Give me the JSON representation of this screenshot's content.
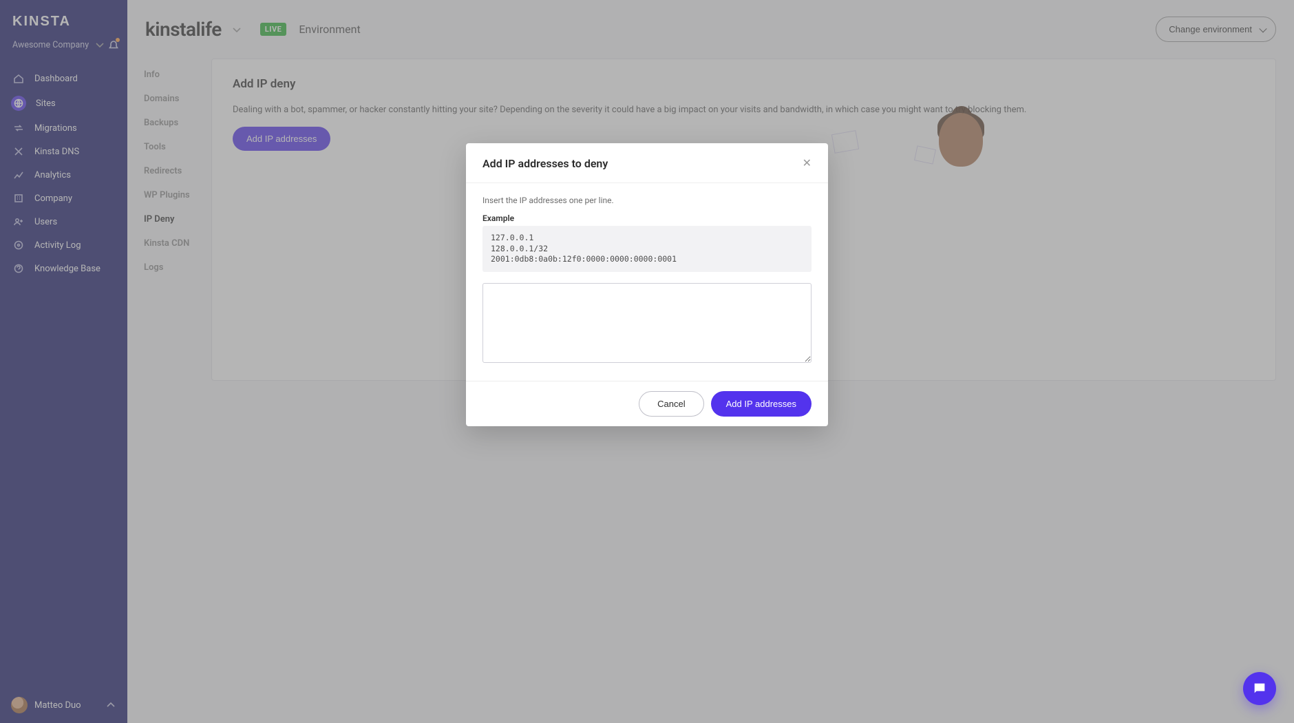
{
  "brand": "KINSTA",
  "company_name": "Awesome Company",
  "sidebar": {
    "items": [
      {
        "label": "Dashboard",
        "icon": "home-icon"
      },
      {
        "label": "Sites",
        "icon": "sites-icon"
      },
      {
        "label": "Migrations",
        "icon": "migrations-icon"
      },
      {
        "label": "Kinsta DNS",
        "icon": "dns-icon"
      },
      {
        "label": "Analytics",
        "icon": "analytics-icon"
      },
      {
        "label": "Company",
        "icon": "company-icon"
      },
      {
        "label": "Users",
        "icon": "users-icon"
      },
      {
        "label": "Activity Log",
        "icon": "activity-icon"
      },
      {
        "label": "Knowledge Base",
        "icon": "help-icon"
      }
    ],
    "active_index": 1
  },
  "user": {
    "name": "Matteo Duo"
  },
  "header": {
    "site_name": "kinstalife",
    "env_badge": "LIVE",
    "env_label": "Environment",
    "change_env": "Change environment"
  },
  "subnav": {
    "items": [
      "Info",
      "Domains",
      "Backups",
      "Tools",
      "Redirects",
      "WP Plugins",
      "IP Deny",
      "Kinsta CDN",
      "Logs"
    ],
    "active_index": 6
  },
  "panel": {
    "title": "Add IP deny",
    "desc": "Dealing with a bot, spammer, or hacker constantly hitting your site? Depending on the severity it could have a big impact on your visits and bandwidth, in which case you might want to try blocking them.",
    "button": "Add IP addresses"
  },
  "modal": {
    "title": "Add IP addresses to deny",
    "hint": "Insert the IP addresses one per line.",
    "example_label": "Example",
    "example": "127.0.0.1\n128.0.0.1/32\n2001:0db8:0a0b:12f0:0000:0000:0000:0001",
    "textarea_value": "",
    "cancel": "Cancel",
    "submit": "Add IP addresses"
  }
}
